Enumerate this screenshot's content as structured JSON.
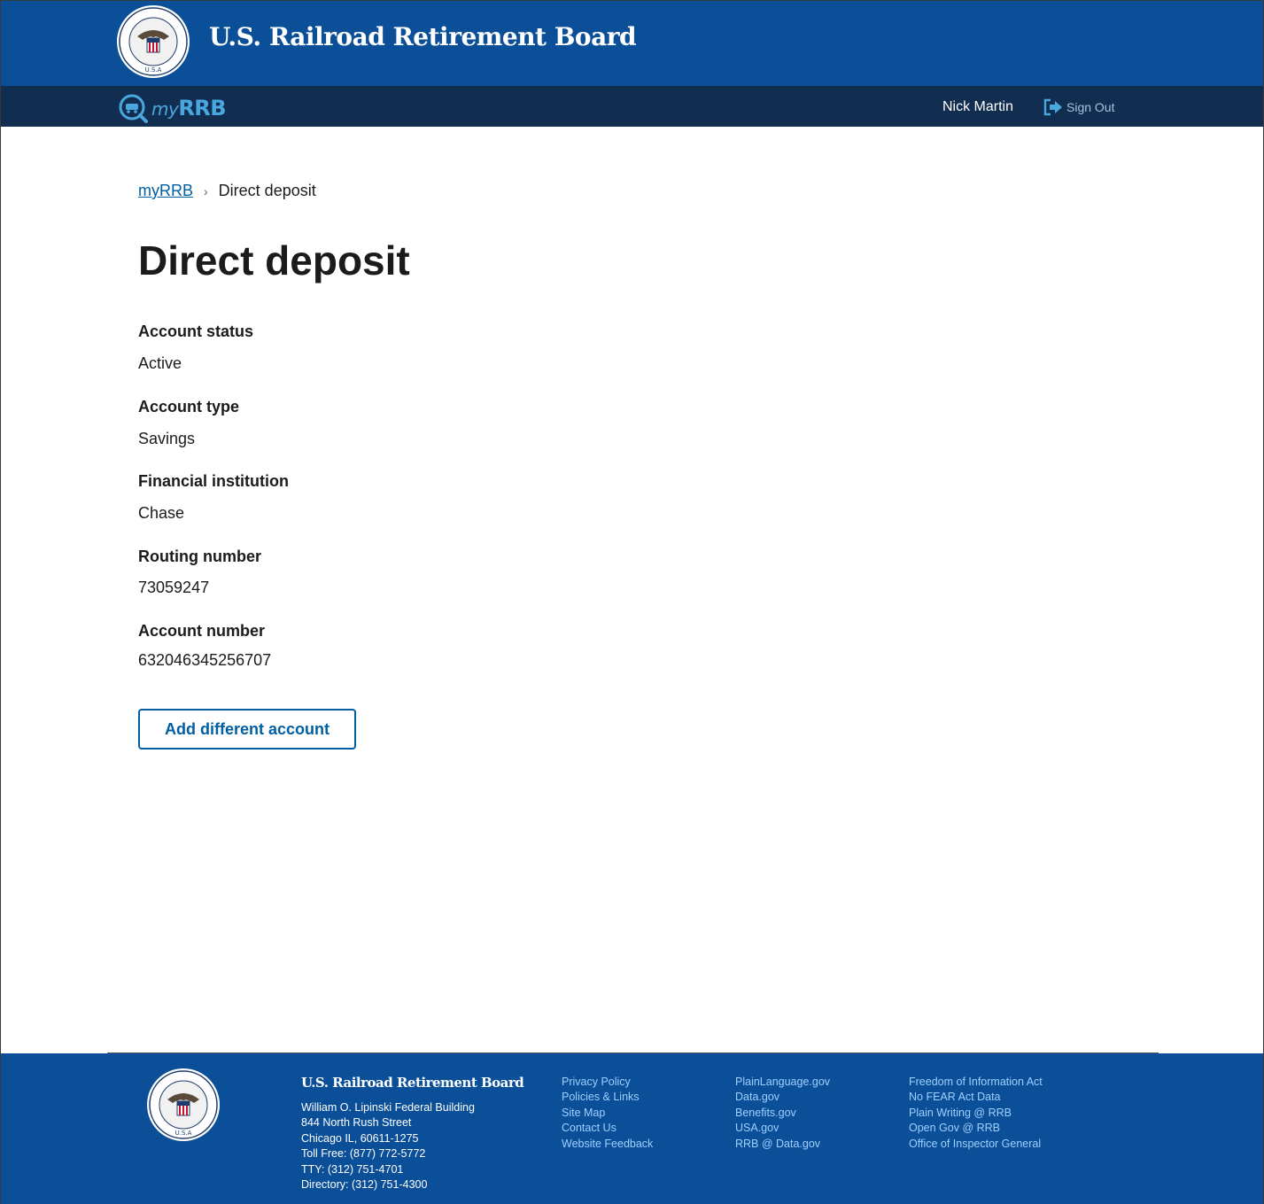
{
  "header": {
    "agency_title": "U.S. Railroad Retirement Board",
    "seal_text": "RAILROAD RETIREMENT BOARD · U.S.A",
    "brand": {
      "prefix": "my",
      "suffix": "RRB"
    },
    "user_name": "Nick Martin",
    "sign_out_label": "Sign Out"
  },
  "breadcrumb": {
    "home_label": "myRRB",
    "current_label": "Direct deposit"
  },
  "page_title": "Direct deposit",
  "fields": [
    {
      "label": "Account status",
      "value": "Active"
    },
    {
      "label": "Account type",
      "value": "Savings"
    },
    {
      "label": "Financial institution",
      "value": "Chase"
    },
    {
      "label": "Routing number",
      "value": "73059247"
    },
    {
      "label": "Account number",
      "value": "632046345256707"
    }
  ],
  "add_account_label": "Add different account",
  "footer": {
    "org_name": "U.S. Railroad Retirement Board",
    "address": [
      "William O. Lipinski Federal Building",
      "844 North Rush Street",
      "Chicago IL, 60611-1275",
      "Toll Free: (877) 772-5772",
      "TTY: (312) 751-4701",
      "Directory: (312) 751-4300"
    ],
    "links_col1": [
      "Privacy Policy",
      "Policies & Links",
      "Site Map",
      "Contact Us",
      "Website Feedback"
    ],
    "links_col2": [
      "PlainLanguage.gov",
      "Data.gov",
      "Benefits.gov",
      "USA.gov",
      "RRB @ Data.gov"
    ],
    "links_col3": [
      "Freedom of Information Act",
      "No FEAR Act Data",
      "Plain Writing @ RRB",
      "Open Gov @ RRB",
      "Office of Inspector General"
    ]
  },
  "colors": {
    "banner_blue": "#0b4f99",
    "nav_navy": "#112e51",
    "link_blue": "#005ea2",
    "brand_cyan": "#4aa6df"
  }
}
